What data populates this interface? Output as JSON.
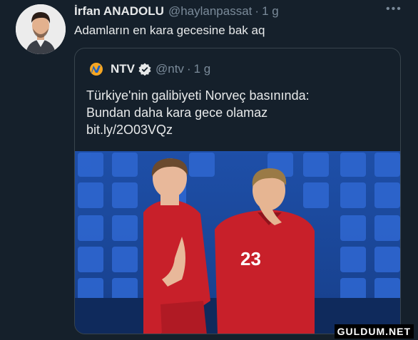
{
  "tweet": {
    "author_name": "İrfan ANADOLU",
    "handle": "@haylanpassat",
    "time": "1 g",
    "separator": "·",
    "text": "Adamların en kara gecesine bak aq",
    "more_icon": "more-icon"
  },
  "quote": {
    "author_name": "NTV",
    "handle": "@ntv",
    "time": "1 g",
    "separator": "·",
    "verified_icon": "verified-badge-icon",
    "text_line1": "Türkiye'nin galibiyeti Norveç basınında:",
    "text_line2": "Bundan daha kara gece olamaz",
    "link": "bit.ly/2O03VQz",
    "jersey_number": "23"
  },
  "watermark": "GULDUM.NET",
  "colors": {
    "background": "#15202b",
    "card_border": "#38444d",
    "text_primary": "#e7e9ea",
    "text_secondary": "#7a8a99",
    "jersey_red": "#c8202a",
    "seats_blue": "#2457b8"
  }
}
